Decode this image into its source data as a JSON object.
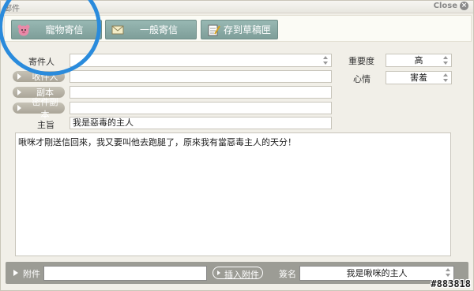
{
  "window": {
    "title": "郵件",
    "close_label": "Close"
  },
  "toolbar": {
    "pet_mail_label": "寵物寄信",
    "normal_mail_label": "一般寄信",
    "save_draft_label": "存到草稿匣"
  },
  "form": {
    "sender_label": "寄件人",
    "sender_value": "",
    "recipient_label": "收件人",
    "recipient_value": "",
    "cc_label": "副本",
    "cc_value": "",
    "bcc_label": "密件副本",
    "bcc_value": "",
    "subject_label": "主旨",
    "subject_value": "我是惡毒的主人",
    "priority_label": "重要度",
    "priority_value": "高",
    "mood_label": "心情",
    "mood_value": "害羞"
  },
  "message": {
    "body": "啾咪才剛送信回來，我又要叫他去跑腿了，原來我有當惡毒主人的天分！"
  },
  "bottom": {
    "attach_label": "附件",
    "attach_value": "",
    "insert_attach_label": "插入附件",
    "signature_label": "簽名",
    "signature_value": "我是啾咪的主人"
  },
  "watermark": "#883818",
  "colors": {
    "toolbar_button": "#8aaaa5",
    "highlight_circle": "#2a8bdc",
    "bottom_bar": "#9c9c95"
  }
}
